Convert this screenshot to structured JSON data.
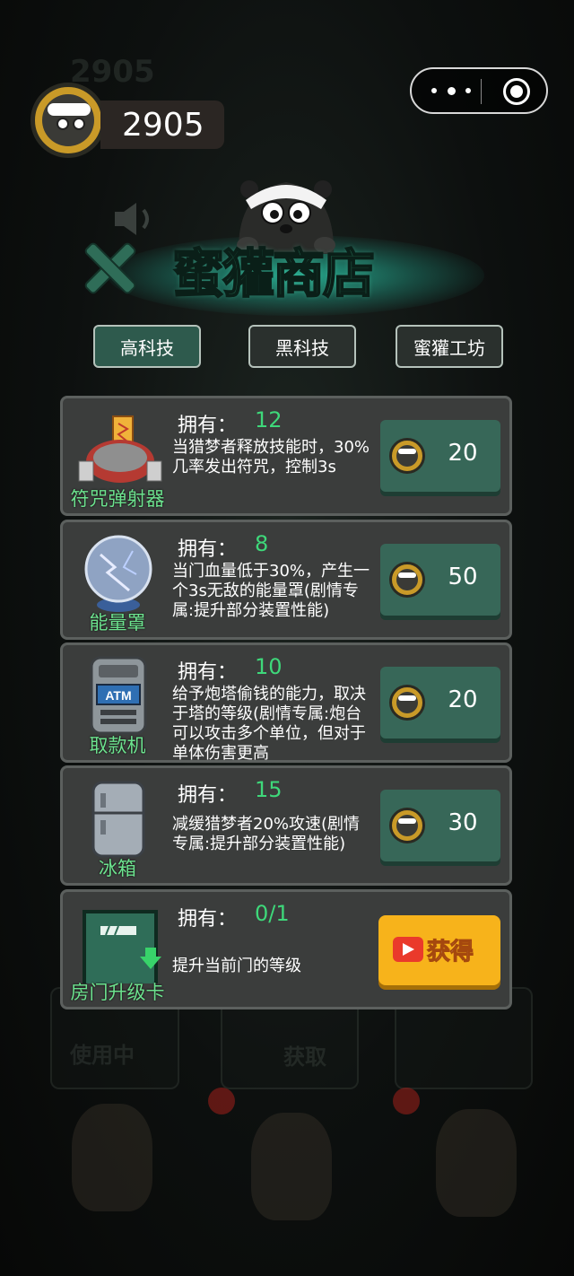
{
  "player": {
    "coins": "2905",
    "background_coin_echo": "2905"
  },
  "miniprogram_capsule": {
    "menu_icon": "more-dots-icon",
    "close_icon": "target-close-icon"
  },
  "shop": {
    "title": "蜜獾商店",
    "tabs": [
      {
        "label": "高科技",
        "active": true
      },
      {
        "label": "黑科技",
        "active": false
      },
      {
        "label": "蜜獾工坊",
        "active": false
      }
    ],
    "own_label": "拥有：",
    "items": [
      {
        "name": "符咒弹射器",
        "owned": "12",
        "description": "当猎梦者释放技能时，30%几率发出符咒，控制3s",
        "price": "20",
        "icon": "talisman-launcher-icon"
      },
      {
        "name": "能量罩",
        "owned": "8",
        "description": "当门血量低于30%，产生一个3s无敌的能量罩(剧情专属:提升部分装置性能)",
        "price": "50",
        "icon": "energy-orb-icon"
      },
      {
        "name": "取款机",
        "owned": "10",
        "description": "给予炮塔偷钱的能力，取决于塔的等级(剧情专属:炮台可以攻击多个单位，但对于单体伤害更高",
        "price": "20",
        "icon": "atm-icon"
      },
      {
        "name": "冰箱",
        "owned": "15",
        "description": "减缓猎梦者20%攻速(剧情专属:提升部分装置性能)",
        "price": "30",
        "icon": "fridge-icon"
      },
      {
        "name": "房门升级卡",
        "owned": "0/1",
        "description": "提升当前门的等级",
        "action_label": "获得",
        "icon": "door-upgrade-icon"
      }
    ]
  },
  "background": {
    "in_use_label": "使用中",
    "get_label": "获取"
  },
  "colors": {
    "accent_green": "#3ed87a",
    "button_teal": "#376758",
    "get_yellow": "#f7b31b",
    "title_green": "#1f5a45"
  }
}
